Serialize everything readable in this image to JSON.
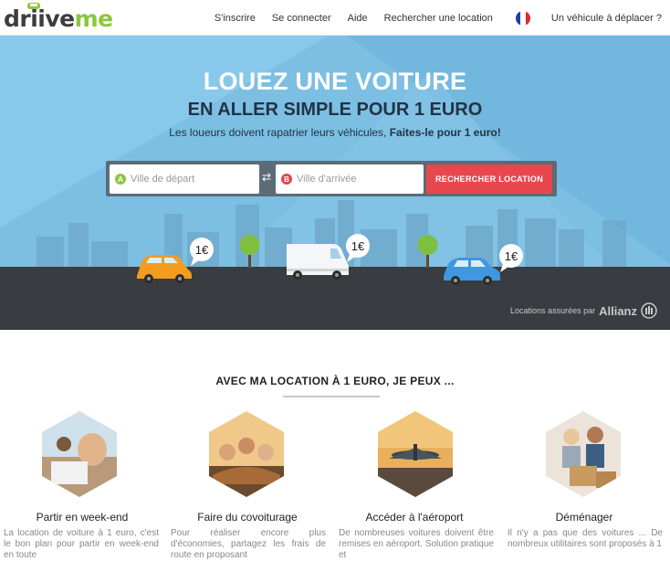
{
  "header": {
    "logo": {
      "prefix": "driive",
      "suffix": "me"
    },
    "nav": [
      {
        "id": "signup",
        "label": "S'inscrire"
      },
      {
        "id": "login",
        "label": "Se connecter"
      },
      {
        "id": "help",
        "label": "Aide"
      },
      {
        "id": "search",
        "label": "Rechercher une location"
      },
      {
        "id": "relocate",
        "label": "Un véhicule à déplacer ?"
      }
    ]
  },
  "hero": {
    "title_line1": "LOUEZ UNE VOITURE",
    "title_line2": "EN ALLER SIMPLE POUR 1 EURO",
    "subtitle_plain": "Les loueurs doivent rapatrier leurs véhicules, ",
    "subtitle_bold": "Faites-le pour 1 euro!",
    "search": {
      "start_badge": "A",
      "start_placeholder": "Ville de départ",
      "end_badge": "B",
      "end_placeholder": "Ville d'arrivée",
      "button_label": "RECHERCHER LOCATION",
      "swap_glyph": "⇄"
    },
    "price_tags": [
      "1€",
      "1€",
      "1€"
    ],
    "insurance_prefix": "Locations assurées par",
    "insurance_brand": "Allianz",
    "colors": {
      "sky": "#7cbfe3",
      "road": "#393c40",
      "button": "#e8474e",
      "accent": "#8cc63f"
    }
  },
  "benefits": {
    "title": "AVEC MA LOCATION À 1 EURO, JE PEUX ...",
    "items": [
      {
        "title": "Partir en week-end",
        "text": "La location de voiture à 1 euro, c'est le bon plan pour partir en week-end en toute"
      },
      {
        "title": "Faire du covoiturage",
        "text": "Pour réaliser encore plus d'économies, partagez les frais de route en proposant"
      },
      {
        "title": "Accéder à l'aéroport",
        "text": "De nombreuses voitures doivent être remises en aéroport. Solution pratique et"
      },
      {
        "title": "Déménager",
        "text": "Il n'y a pas que des voitures ... De nombreux utilitaires sont proposés à 1"
      }
    ]
  }
}
